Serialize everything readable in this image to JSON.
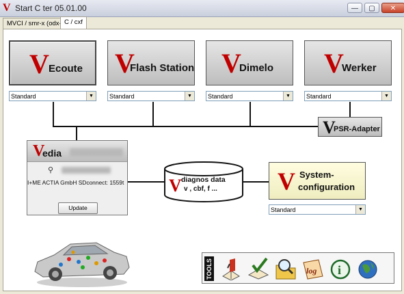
{
  "window": {
    "title": "Start C  ter 05.01.00",
    "minimize_glyph": "—",
    "maximize_glyph": "▢",
    "close_glyph": "✕"
  },
  "tabs": [
    {
      "label": "MVCI / smr-x (odx-x)",
      "active": false
    },
    {
      "label": "C      / cxf",
      "active": true
    }
  ],
  "modules": [
    {
      "logo": "V",
      "label": "Ecoute",
      "dropdown": "Standard"
    },
    {
      "logo": "V",
      "label": "Flash Station",
      "dropdown": "Standard"
    },
    {
      "logo": "V",
      "label": "Dimelo",
      "dropdown": "Standard"
    },
    {
      "logo": "V",
      "label": "Werker",
      "dropdown": "Standard"
    }
  ],
  "psr_adapter": {
    "logo": "V",
    "label": "PSR-Adapter"
  },
  "vedia": {
    "logo": "V",
    "name": "edia",
    "device": "I+ME ACTIA GmbH SDconnect: 1559t",
    "update_label": "Update"
  },
  "diagnostic_data": {
    "logo": "V",
    "line1": "diagnos   data",
    "line2": "v   , cbf,   f ..."
  },
  "system_config": {
    "logo": "V",
    "line1": "System-",
    "line2": "configuration",
    "dropdown": "Standard"
  },
  "tools": {
    "label": "TOOLS",
    "items": [
      {
        "icon": "manual-book-icon"
      },
      {
        "icon": "checklist-icon"
      },
      {
        "icon": "folder-search-icon"
      },
      {
        "icon": "log-icon"
      },
      {
        "icon": "info-icon"
      },
      {
        "icon": "globe-icon"
      }
    ]
  },
  "colors": {
    "brand_red": "#c00000",
    "system_config_bg": "#fffde0"
  }
}
